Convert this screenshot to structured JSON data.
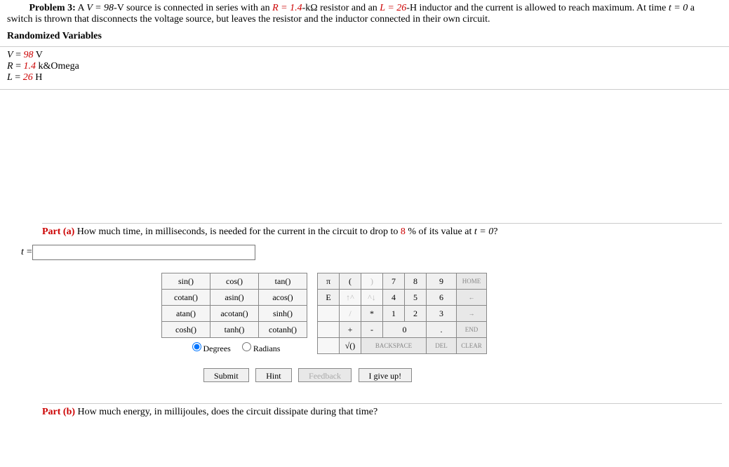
{
  "problem": {
    "number_label": "Problem 3:",
    "text_prefix": "A ",
    "V_expr": "V = 98",
    "text_mid1": "-V source is connected in series with an ",
    "R_expr": "R = 1.4",
    "text_mid2": "-kΩ resistor and an ",
    "L_expr": "L = 26",
    "text_mid3": "-H inductor and the current is allowed to reach maximum. At time ",
    "t_expr": "t = 0",
    "text_end": " a switch is thrown that disconnects the voltage source, but leaves the resistor and the inductor connected in their own circuit."
  },
  "rand_vars": {
    "heading": "Randomized Variables",
    "V": {
      "sym": "V",
      "eq": " = ",
      "val": "98",
      "unit": " V"
    },
    "R": {
      "sym": "R",
      "eq": " = ",
      "val": "1.4",
      "unit": " k&Omega"
    },
    "L": {
      "sym": "L",
      "eq": " = ",
      "val": "26",
      "unit": " H"
    }
  },
  "part_a": {
    "label": "Part (a)",
    "text_pre": " How much time, in milliseconds, is needed for the current in the circuit to drop to ",
    "percent": "8",
    "text_post": " % of its value at ",
    "t_expr": "t = 0",
    "qmark": "?",
    "answer_sym": "t",
    "equals": " = "
  },
  "keypad": {
    "funcs": [
      [
        "sin()",
        "cos()",
        "tan()"
      ],
      [
        "cotan()",
        "asin()",
        "acos()"
      ],
      [
        "atan()",
        "acotan()",
        "sinh()"
      ],
      [
        "cosh()",
        "tanh()",
        "cotanh()"
      ]
    ],
    "degrees": "Degrees",
    "radians": "Radians",
    "num": {
      "r1": [
        "π",
        "(",
        ")",
        "7",
        "8",
        "9"
      ],
      "r1_home": "HOME",
      "r2": [
        "E",
        "↑^",
        "^↓",
        "4",
        "5",
        "6"
      ],
      "r2_left": "←",
      "r3_a": "/",
      "r3_b": "*",
      "r3_c": "1",
      "r3_d": "2",
      "r3_e": "3",
      "r3_right": "→",
      "r4_plus": "+",
      "r4_minus": "-",
      "r4_zero": "0",
      "r4_dot": ".",
      "r4_end": "END",
      "r5_sqrt": "√()",
      "r5_bksp": "BACKSPACE",
      "r5_del": "DEL",
      "r5_clear": "CLEAR"
    }
  },
  "actions": {
    "submit": "Submit",
    "hint": "Hint",
    "feedback": "Feedback",
    "giveup": "I give up!"
  },
  "part_b": {
    "label": "Part (b)",
    "text": " How much energy, in millijoules, does the circuit dissipate during that time?"
  }
}
